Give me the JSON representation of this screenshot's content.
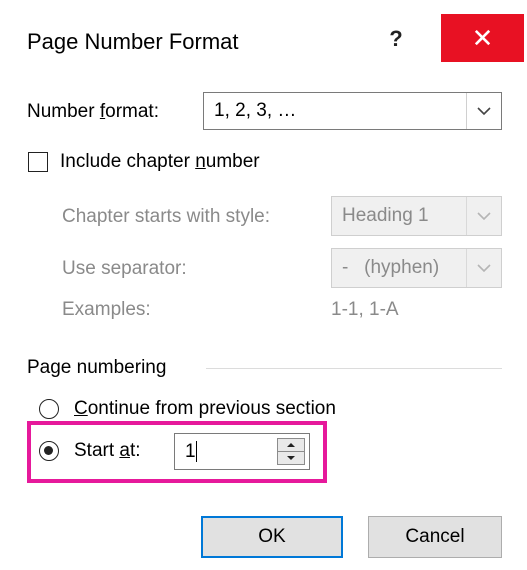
{
  "window": {
    "title": "Page Number Format",
    "help_label": "?",
    "close_glyph": "✕",
    "close_color": "#e81123"
  },
  "number_format": {
    "label_prefix": "Number ",
    "label_underline": "f",
    "label_suffix": "ormat:",
    "value": "1, 2, 3, …"
  },
  "chapter": {
    "checkbox_label_prefix": "Include chapter ",
    "checkbox_label_underline": "n",
    "checkbox_label_suffix": "umber",
    "checked": false,
    "starts_with_style_label": "Chapter starts with style:",
    "starts_with_style_value": "Heading 1",
    "separator_label": "Use separator:",
    "separator_value": "-   (hyphen)",
    "examples_label": "Examples:",
    "examples_value": "1-1, 1-A"
  },
  "page_numbering": {
    "group_label": "Page numbering",
    "continue_label_underline": "C",
    "continue_label_suffix": "ontinue from previous section",
    "continue_selected": false,
    "start_at_label_prefix": "Start ",
    "start_at_label_underline": "a",
    "start_at_label_suffix": "t:",
    "start_at_selected": true,
    "start_at_value": "1",
    "highlight_color": "#e6199b"
  },
  "buttons": {
    "ok_label": "OK",
    "cancel_label": "Cancel",
    "accent": "#0078d7"
  },
  "icons": {
    "dropdown": "chevron-down-icon",
    "spin_up": "triangle-up-icon",
    "spin_down": "triangle-down-icon"
  }
}
